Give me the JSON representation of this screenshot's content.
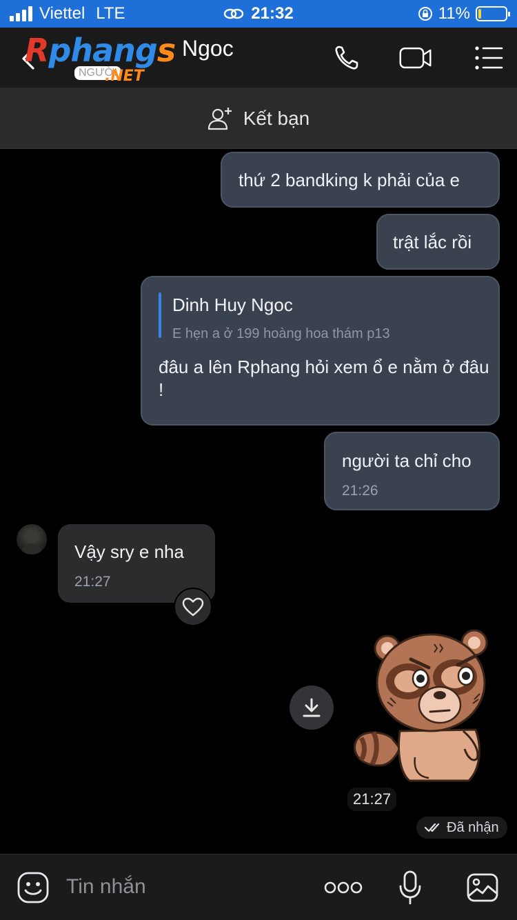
{
  "status_bar": {
    "carrier": "Viettel",
    "network": "LTE",
    "time": "21:32",
    "battery_percent": "11%",
    "battery_level": 0.11
  },
  "header": {
    "logo_text": "Rphangs",
    "logo_net": ".NET",
    "logo_badge": "NGƯỜI",
    "contact_name_visible": "Ngoc",
    "icons": [
      "back-icon",
      "phone-icon",
      "video-call-icon",
      "menu-icon"
    ]
  },
  "add_friend": {
    "label": "Kết bạn",
    "icon": "add-user-icon"
  },
  "messages": [
    {
      "direction": "out",
      "text": "thứ 2 bandking k phải của e"
    },
    {
      "direction": "out",
      "text": "trật lắc rồi"
    },
    {
      "direction": "out",
      "quote": {
        "author": "Dinh Huy Ngoc",
        "text": "E hẹn a ở 199 hoàng hoa thám p13"
      },
      "text": "đâu a lên Rphang hỏi xem ổ e nằm ở đâu !"
    },
    {
      "direction": "out",
      "text": "người ta chỉ cho",
      "time": "21:26"
    },
    {
      "direction": "in",
      "text": "Vậy sry e nha",
      "time": "21:27"
    },
    {
      "direction": "out",
      "type": "sticker",
      "sticker": "angry-raccoon-sticker",
      "time": "21:27",
      "status": "Đã nhận"
    }
  ],
  "input": {
    "placeholder": "Tin nhắn",
    "icons": [
      "emoji-icon",
      "more-icon",
      "microphone-icon",
      "image-icon"
    ]
  },
  "colors": {
    "status_bar_bg": "#1f6fd9",
    "outgoing_bubble": "#3a4250",
    "incoming_bubble": "#2c2c2e",
    "quote_accent": "#3a82e8",
    "background": "#000000"
  }
}
